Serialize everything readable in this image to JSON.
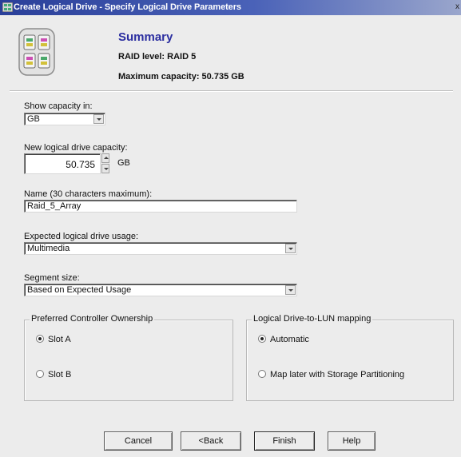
{
  "window": {
    "title": "Create Logical Drive - Specify Logical Drive Parameters",
    "close_glyph": "x"
  },
  "summary": {
    "heading": "Summary",
    "raid_level": "RAID level: RAID 5",
    "max_capacity": "Maximum capacity: 50.735 GB",
    "icon": "disk-array-icon"
  },
  "show_capacity": {
    "label": "Show capacity in:",
    "value": "GB"
  },
  "new_capacity": {
    "label": "New logical drive capacity:",
    "value": "50.735",
    "unit": "GB"
  },
  "name_field": {
    "label": "Name (30 characters maximum):",
    "value": "Raid_5_Array"
  },
  "usage": {
    "label": "Expected logical drive usage:",
    "value": "Multimedia"
  },
  "segment": {
    "label": "Segment size:",
    "value": "Based on Expected Usage"
  },
  "controller_group": {
    "title": "Preferred Controller Ownership",
    "options": [
      {
        "label": "Slot A",
        "selected": true
      },
      {
        "label": "Slot B",
        "selected": false
      }
    ]
  },
  "lun_group": {
    "title": "Logical Drive-to-LUN mapping",
    "options": [
      {
        "label": "Automatic",
        "selected": true
      },
      {
        "label": "Map later with Storage Partitioning",
        "selected": false
      }
    ]
  },
  "buttons": {
    "cancel": "Cancel",
    "back": "<Back",
    "finish": "Finish",
    "help": "Help"
  },
  "colors": {
    "titlebar": "#2a3f99",
    "summary_heading": "#2b2ea0",
    "dialog_bg": "#ececec"
  }
}
